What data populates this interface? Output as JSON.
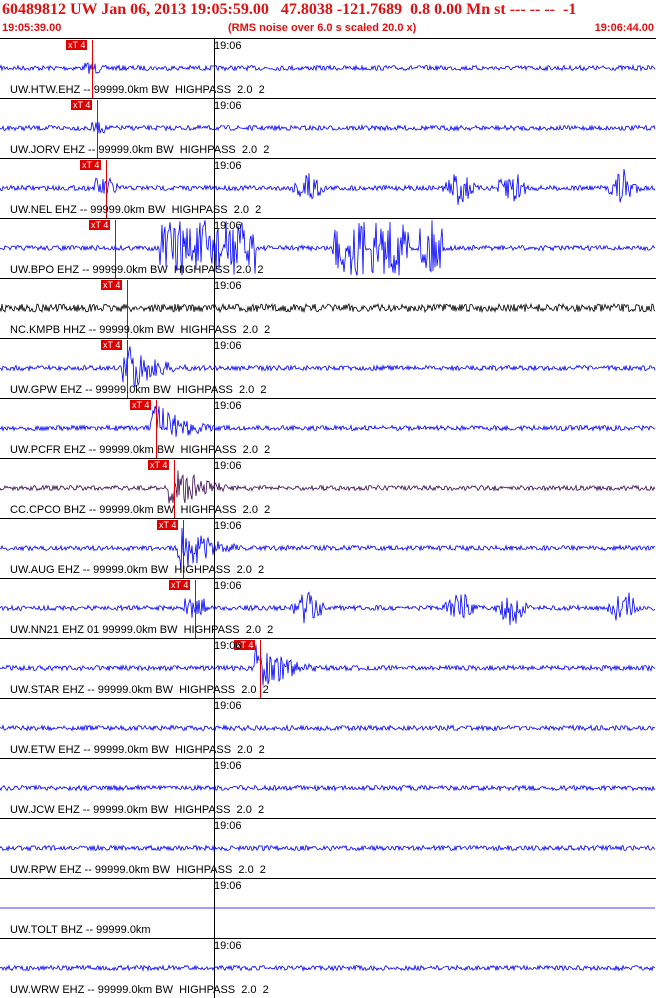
{
  "header": {
    "title": "60489812 UW Jan 06, 2013 19:05:59.00   47.8038 -121.7689  0.8 0.00 Mn st --- -- --  -1",
    "start_time": "19:05:39.00",
    "note": "(RMS noise over 6.0 s scaled 20.0 x)",
    "end_time": "19:06:44.00"
  },
  "time_tick_label": "19:06",
  "pick_label": "xT 4",
  "colors": {
    "header_text": "#e01010",
    "trace_blue": "#0000ff",
    "trace_black": "#000000",
    "trace_purple": "#3a0a50",
    "pick_red": "#e00000",
    "separator": "#000000"
  },
  "traces": [
    {
      "id": "htw",
      "label": "UW.HTW.EHZ -- 99999.0km BW  HIGHPASS  2.0  2",
      "color": "blue",
      "pick_time": 0.31,
      "amp": "low"
    },
    {
      "id": "jorv",
      "label": "UW.JORV EHZ -- 99999.0km BW  HIGHPASS  2.0  2",
      "color": "blue",
      "pick_time": 0.33,
      "amp": "low"
    },
    {
      "id": "nel",
      "label": "UW.NEL EHZ -- 99999.0km BW  HIGHPASS  2.0  2",
      "color": "blue",
      "pick_time": 0.36,
      "amp": "bursts"
    },
    {
      "id": "bpo",
      "label": "UW.BPO EHZ -- 99999.0km BW  HIGHPASS  2.0  2",
      "color": "blue",
      "pick_time": 0.39,
      "amp": "clipped"
    },
    {
      "id": "kmpb",
      "label": "NC.KMPB HHZ -- 99999.0km BW  HIGHPASS  2.0  2",
      "color": "black",
      "pick_time": 0.43,
      "amp": "medium"
    },
    {
      "id": "gpw",
      "label": "UW.GPW EHZ -- 99999.0km BW  HIGHPASS  2.0  2",
      "color": "blue",
      "pick_time": 0.43,
      "amp": "event"
    },
    {
      "id": "pcfr",
      "label": "UW.PCFR EHZ -- 99999.0km BW  HIGHPASS  2.0  2",
      "color": "blue",
      "pick_time": 0.53,
      "amp": "event"
    },
    {
      "id": "cpco",
      "label": "CC.CPCO BHZ -- 99999.0km BW  HIGHPASS  2.0  2",
      "color": "purple",
      "pick_time": 0.59,
      "amp": "event"
    },
    {
      "id": "aug",
      "label": "UW.AUG EHZ -- 99999.0km BW  HIGHPASS  2.0  2",
      "color": "blue",
      "pick_time": 0.62,
      "amp": "event"
    },
    {
      "id": "nn21",
      "label": "UW.NN21 EHZ 01 99999.0km BW  HIGHPASS  2.0  2",
      "color": "blue",
      "pick_time": 0.66,
      "amp": "bursts"
    },
    {
      "id": "star",
      "label": "UW.STAR EHZ -- 99999.0km BW  HIGHPASS  2.0  2",
      "color": "blue",
      "pick_time": 0.88,
      "amp": "event"
    },
    {
      "id": "etw",
      "label": "UW.ETW EHZ -- 99999.0km BW  HIGHPASS  2.0  2",
      "color": "blue",
      "pick_time": null,
      "amp": "low"
    },
    {
      "id": "jcw",
      "label": "UW.JCW EHZ -- 99999.0km BW  HIGHPASS  2.0  2",
      "color": "blue",
      "pick_time": null,
      "amp": "low"
    },
    {
      "id": "rpw",
      "label": "UW.RPW EHZ -- 99999.0km BW  HIGHPASS  2.0  2",
      "color": "blue",
      "pick_time": null,
      "amp": "low"
    },
    {
      "id": "tolt",
      "label": "UW.TOLT BHZ -- 99999.0km",
      "color": "blue",
      "pick_time": null,
      "amp": "none"
    },
    {
      "id": "wrw",
      "label": "UW.WRW EHZ -- 99999.0km BW  HIGHPASS  2.0  2",
      "color": "blue",
      "pick_time": null,
      "amp": "low"
    }
  ]
}
